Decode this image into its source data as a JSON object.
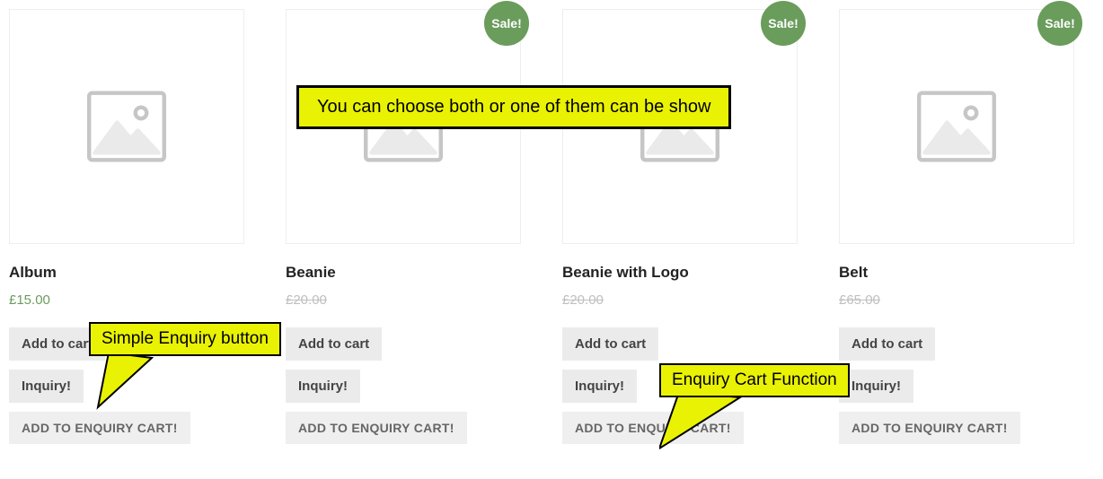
{
  "common": {
    "sale_badge": "Sale!",
    "add_to_cart": "Add to cart",
    "inquiry": "Inquiry!",
    "add_to_enquiry": "ADD TO ENQUIRY CART!"
  },
  "products": [
    {
      "title": "Album",
      "price": "£15.00",
      "on_sale": false
    },
    {
      "title": "Beanie",
      "price": "£20.00",
      "on_sale": true
    },
    {
      "title": "Beanie with Logo",
      "price": "£20.00",
      "on_sale": true
    },
    {
      "title": "Belt",
      "price": "£65.00",
      "on_sale": true
    }
  ],
  "annotations": {
    "top_note": "You can choose both or one of them can be show",
    "callout_simple": "Simple Enquiry button",
    "callout_cart": "Enquiry Cart Function"
  }
}
